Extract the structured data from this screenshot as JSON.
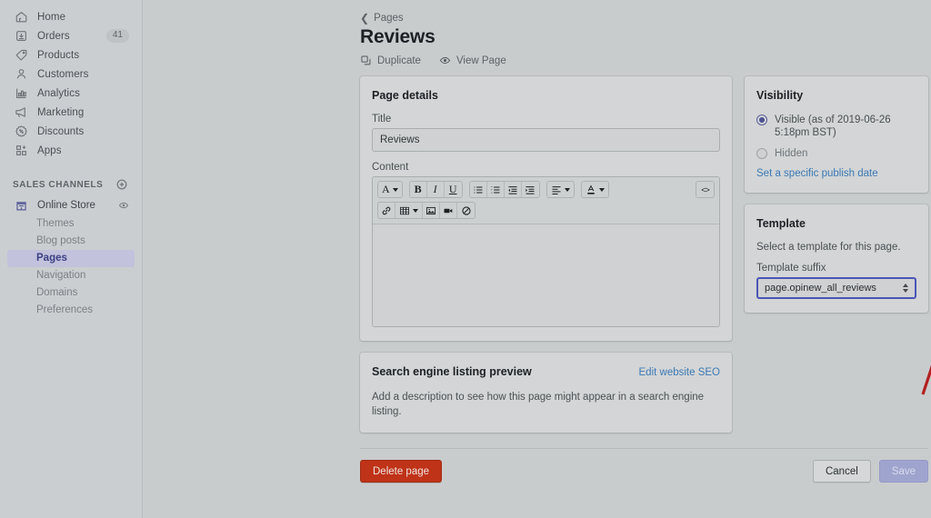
{
  "sidebar": {
    "nav_items": [
      {
        "label": "Home",
        "icon": "home-icon",
        "badge": ""
      },
      {
        "label": "Orders",
        "icon": "orders-icon",
        "badge": "41"
      },
      {
        "label": "Products",
        "icon": "products-tag-icon",
        "badge": ""
      },
      {
        "label": "Customers",
        "icon": "customers-person-icon",
        "badge": ""
      },
      {
        "label": "Analytics",
        "icon": "analytics-bar-chart-icon",
        "badge": ""
      },
      {
        "label": "Marketing",
        "icon": "marketing-megaphone-icon",
        "badge": ""
      },
      {
        "label": "Discounts",
        "icon": "discounts-percent-icon",
        "badge": ""
      },
      {
        "label": "Apps",
        "icon": "apps-grid-plus-icon",
        "badge": ""
      }
    ],
    "section": {
      "title": "SALES CHANNELS",
      "add_icon": "plus-circle-icon"
    },
    "channel": {
      "label": "Online Store",
      "icon": "storefront-icon",
      "view_icon": "eye-icon"
    },
    "sub_items": [
      {
        "label": "Themes",
        "active": false
      },
      {
        "label": "Blog posts",
        "active": false
      },
      {
        "label": "Pages",
        "active": true
      },
      {
        "label": "Navigation",
        "active": false
      },
      {
        "label": "Domains",
        "active": false
      },
      {
        "label": "Preferences",
        "active": false
      }
    ]
  },
  "header": {
    "breadcrumb": "Pages",
    "back_icon": "chevron-left-icon",
    "title": "Reviews",
    "actions": [
      {
        "label": "Duplicate",
        "icon": "duplicate-icon"
      },
      {
        "label": "View Page",
        "icon": "eye-icon"
      }
    ]
  },
  "page_details": {
    "card_title": "Page details",
    "title_label": "Title",
    "title_value": "Reviews",
    "title_placeholder": "",
    "content_label": "Content",
    "content_value": "",
    "toolbar": {
      "row1": [
        {
          "icon": "font-family-A-icon",
          "glyph": "A",
          "caret": true,
          "name": "font-style-dropdown"
        },
        {
          "icon": "bold-icon",
          "glyph": "B",
          "caret": false,
          "name": "bold-button"
        },
        {
          "icon": "italic-icon",
          "glyph": "I",
          "caret": false,
          "name": "italic-button"
        },
        {
          "icon": "underline-icon",
          "glyph": "U",
          "caret": false,
          "name": "underline-button"
        },
        {
          "icon": "bulleted-list-icon",
          "glyph": "",
          "caret": false,
          "name": "bulleted-list-button"
        },
        {
          "icon": "numbered-list-icon",
          "glyph": "",
          "caret": false,
          "name": "numbered-list-button"
        },
        {
          "icon": "outdent-icon",
          "glyph": "",
          "caret": false,
          "name": "outdent-button"
        },
        {
          "icon": "indent-icon",
          "glyph": "",
          "caret": false,
          "name": "indent-button"
        },
        {
          "icon": "align-icon",
          "glyph": "",
          "caret": true,
          "name": "text-align-dropdown"
        },
        {
          "icon": "text-color-icon",
          "glyph": "",
          "caret": true,
          "name": "text-color-dropdown"
        },
        {
          "icon": "code-view-icon",
          "glyph": "<>",
          "caret": false,
          "name": "show-html-button"
        }
      ],
      "row2": [
        {
          "icon": "link-icon",
          "glyph": "",
          "caret": false,
          "name": "insert-link-button"
        },
        {
          "icon": "table-icon",
          "glyph": "",
          "caret": true,
          "name": "insert-table-dropdown"
        },
        {
          "icon": "image-icon",
          "glyph": "",
          "caret": false,
          "name": "insert-image-button"
        },
        {
          "icon": "video-icon",
          "glyph": "",
          "caret": false,
          "name": "insert-video-button"
        },
        {
          "icon": "clear-formatting-icon",
          "glyph": "",
          "caret": false,
          "name": "clear-formatting-button"
        }
      ]
    }
  },
  "seo": {
    "card_title": "Search engine listing preview",
    "edit_link": "Edit website SEO",
    "description": "Add a description to see how this page might appear in a search engine listing."
  },
  "visibility": {
    "card_title": "Visibility",
    "options": [
      {
        "label": "Visible (as of 2019-06-26 5:18pm BST)",
        "checked": true
      },
      {
        "label": "Hidden",
        "checked": false
      }
    ],
    "publish_date_link": "Set a specific publish date"
  },
  "template": {
    "card_title": "Template",
    "help_text": "Select a template for this page.",
    "suffix_label": "Template suffix",
    "suffix_value": "page.opinew_all_reviews",
    "stepper_icon": "select-stepper-icon"
  },
  "footer": {
    "delete_label": "Delete page",
    "cancel_label": "Cancel",
    "save_label": "Save"
  },
  "annotation": {
    "arrow_color": "#b32020",
    "shape": "arrow-pointing-to-template-suffix"
  },
  "colors": {
    "page_background": "#c9cccd",
    "card_background": "#d3d5d6",
    "sidebar_background": "#cbced0",
    "active_nav_background": "#c2c2dc",
    "active_nav_text": "#3b3f84",
    "link_blue": "#3b7ab5",
    "destructive_red": "#bf3318",
    "focus_indigo": "#4b55b7",
    "annotation_red": "#b32020"
  }
}
